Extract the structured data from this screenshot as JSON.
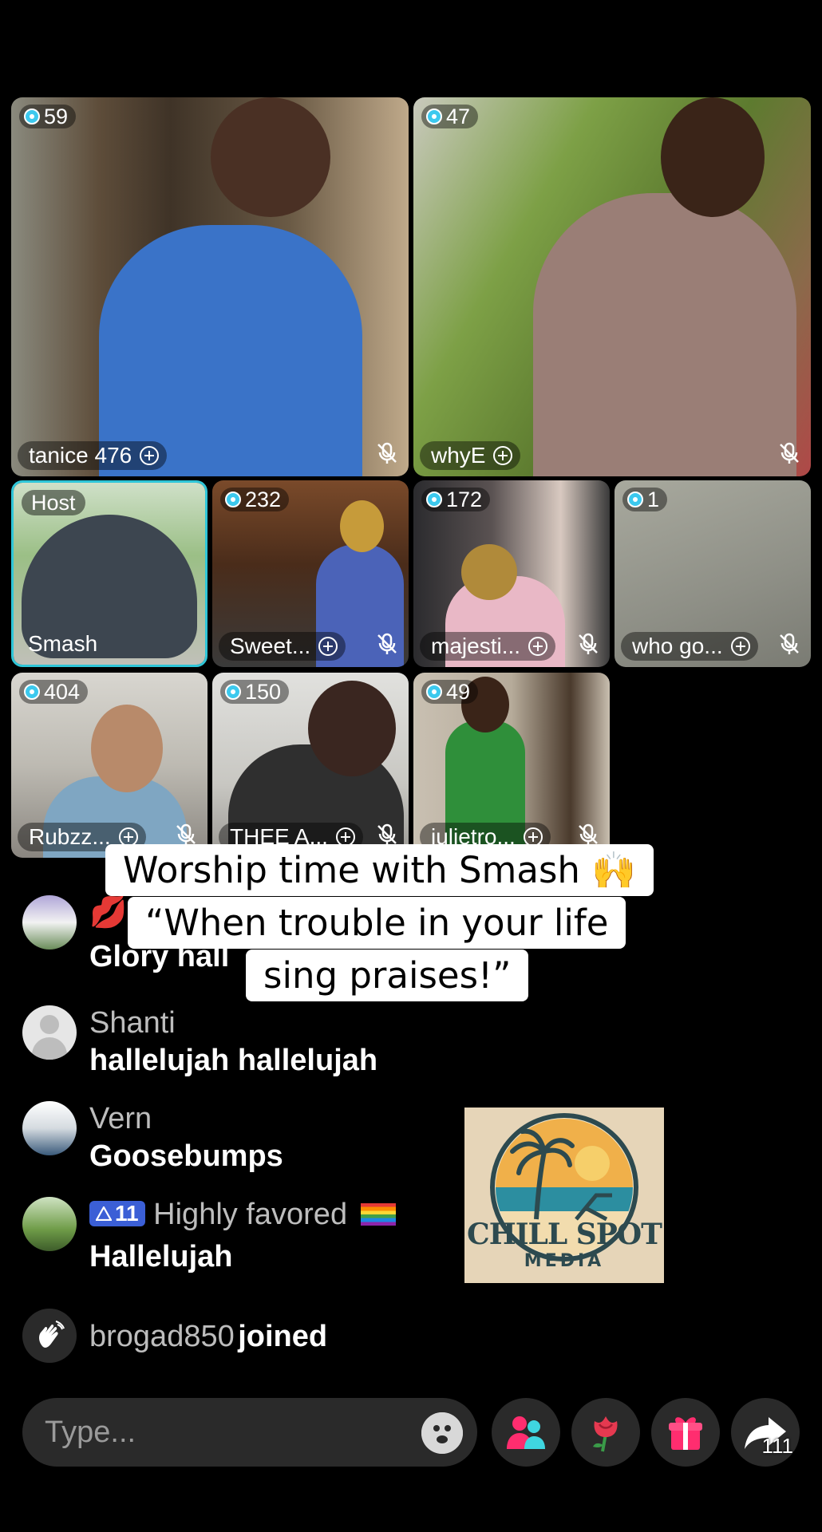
{
  "tiles": [
    {
      "count": "59",
      "name": "tanice 476"
    },
    {
      "count": "47",
      "name": "whyE"
    },
    {
      "host_label": "Host",
      "name": "Smash"
    },
    {
      "count": "232",
      "name": "Sweet..."
    },
    {
      "count": "172",
      "name": "majesti..."
    },
    {
      "count": "1",
      "name": "who go..."
    },
    {
      "count": "404",
      "name": "Rubzz..."
    },
    {
      "count": "150",
      "name": "THEE A..."
    },
    {
      "count": "49",
      "name": "julietro..."
    }
  ],
  "caption": {
    "line1": "Worship time with Smash 🙌",
    "line2": "“When trouble in your life",
    "line3": "sing praises!”"
  },
  "comments": [
    {
      "name": "💋",
      "message": "Glory hall"
    },
    {
      "name": "Shanti",
      "message": "hallelujah hallelujah"
    },
    {
      "name": "Vern",
      "message": "Goosebumps"
    },
    {
      "level": "11",
      "name": "Highly favored",
      "message": "Hallelujah"
    }
  ],
  "join_event": {
    "user": "brogad850",
    "action": "joined"
  },
  "watermark": {
    "line1": "CHILL SPOT",
    "line2": "MEDIA"
  },
  "input": {
    "placeholder": "Type..."
  },
  "share_count": "111",
  "colors": {
    "host_border": "#2fc6d8",
    "badge_dot": "#3cc9ee",
    "level_badge": "#3b5fd6",
    "gift": "#ff2d6f"
  }
}
